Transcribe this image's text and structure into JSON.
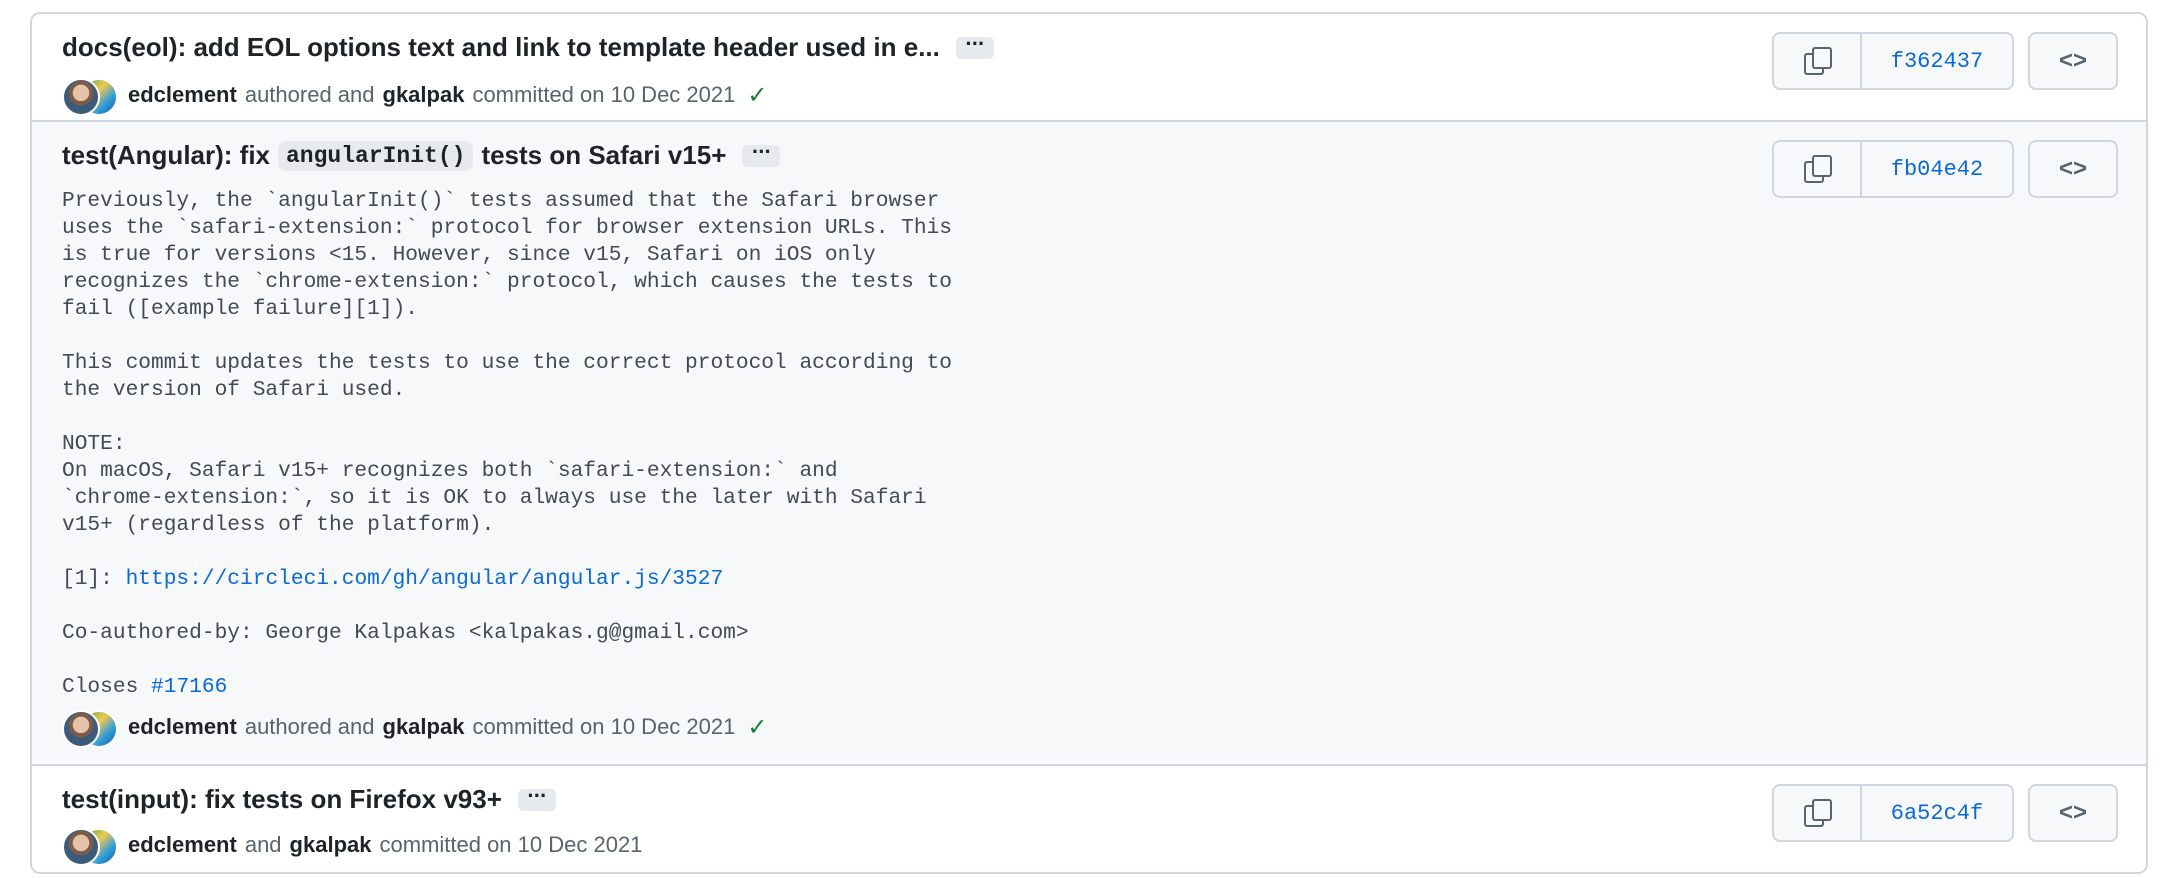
{
  "commits": [
    {
      "title": "docs(eol): add EOL options text and link to template header used in e...",
      "ellipsis": "···",
      "author": "edclement",
      "authored_text": "authored and",
      "committer": "gkalpak",
      "committed_text": "committed on 10 Dec 2021",
      "check": "✓",
      "sha": "f362437",
      "browse": "<>"
    },
    {
      "title_prefix": "test(Angular): fix",
      "title_code": "angularInit()",
      "title_suffix": "tests on Safari v15+",
      "ellipsis": "···",
      "body_p1": "Previously, the `angularInit()` tests assumed that the Safari browser\nuses the `safari-extension:` protocol for browser extension URLs. This\nis true for versions <15. However, since v15, Safari on iOS only\nrecognizes the `chrome-extension:` protocol, which causes the tests to\nfail ([example failure][1]).\n\nThis commit updates the tests to use the correct protocol according to\nthe version of Safari used.\n\nNOTE:\nOn macOS, Safari v15+ recognizes both `safari-extension:` and\n`chrome-extension:`, so it is OK to always use the later with Safari\nv15+ (regardless of the platform).\n\n",
      "ref_label": "[1]: ",
      "ref_link": "https://circleci.com/gh/angular/angular.js/3527",
      "coauthor": "\n\nCo-authored-by: George Kalpakas <kalpakas.g@gmail.com>\n\n",
      "closes_label": "Closes ",
      "closes_link": "#17166",
      "author": "edclement",
      "authored_text": "authored and",
      "committer": "gkalpak",
      "committed_text": "committed on 10 Dec 2021",
      "check": "✓",
      "sha": "fb04e42",
      "browse": "<>"
    },
    {
      "title": "test(input): fix tests on Firefox v93+",
      "ellipsis": "···",
      "author": "edclement",
      "and_text": "and",
      "committer": "gkalpak",
      "committed_text": "committed on 10 Dec 2021",
      "sha": "6a52c4f",
      "browse": "<>"
    }
  ]
}
